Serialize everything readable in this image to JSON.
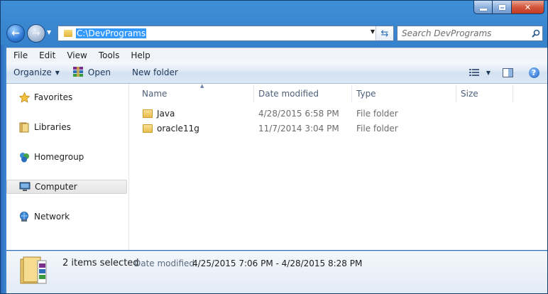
{
  "address": {
    "path": "C:\\DevPrograms"
  },
  "search": {
    "placeholder": "Search DevPrograms"
  },
  "menubar": [
    {
      "label": "File"
    },
    {
      "label": "Edit"
    },
    {
      "label": "View"
    },
    {
      "label": "Tools"
    },
    {
      "label": "Help"
    }
  ],
  "toolbar": {
    "organize": "Organize",
    "open": "Open",
    "new_folder": "New folder"
  },
  "nav": [
    {
      "label": "Favorites"
    },
    {
      "label": "Libraries"
    },
    {
      "label": "Homegroup"
    },
    {
      "label": "Computer"
    },
    {
      "label": "Network"
    }
  ],
  "columns": {
    "name": "Name",
    "date": "Date modified",
    "type": "Type",
    "size": "Size"
  },
  "files": [
    {
      "name": "Java",
      "date": "4/28/2015 6:58 PM",
      "type": "File folder",
      "size": ""
    },
    {
      "name": "oracle11g",
      "date": "11/7/2014 3:04 PM",
      "type": "File folder",
      "size": ""
    }
  ],
  "details": {
    "count": "2 items selected",
    "date_label": "Date modified:",
    "date_value": "4/25/2015 7:06 PM - 4/28/2015 8:28 PM"
  },
  "colors": {
    "selection": "#3399ff",
    "frame": "#2a6fbf"
  }
}
